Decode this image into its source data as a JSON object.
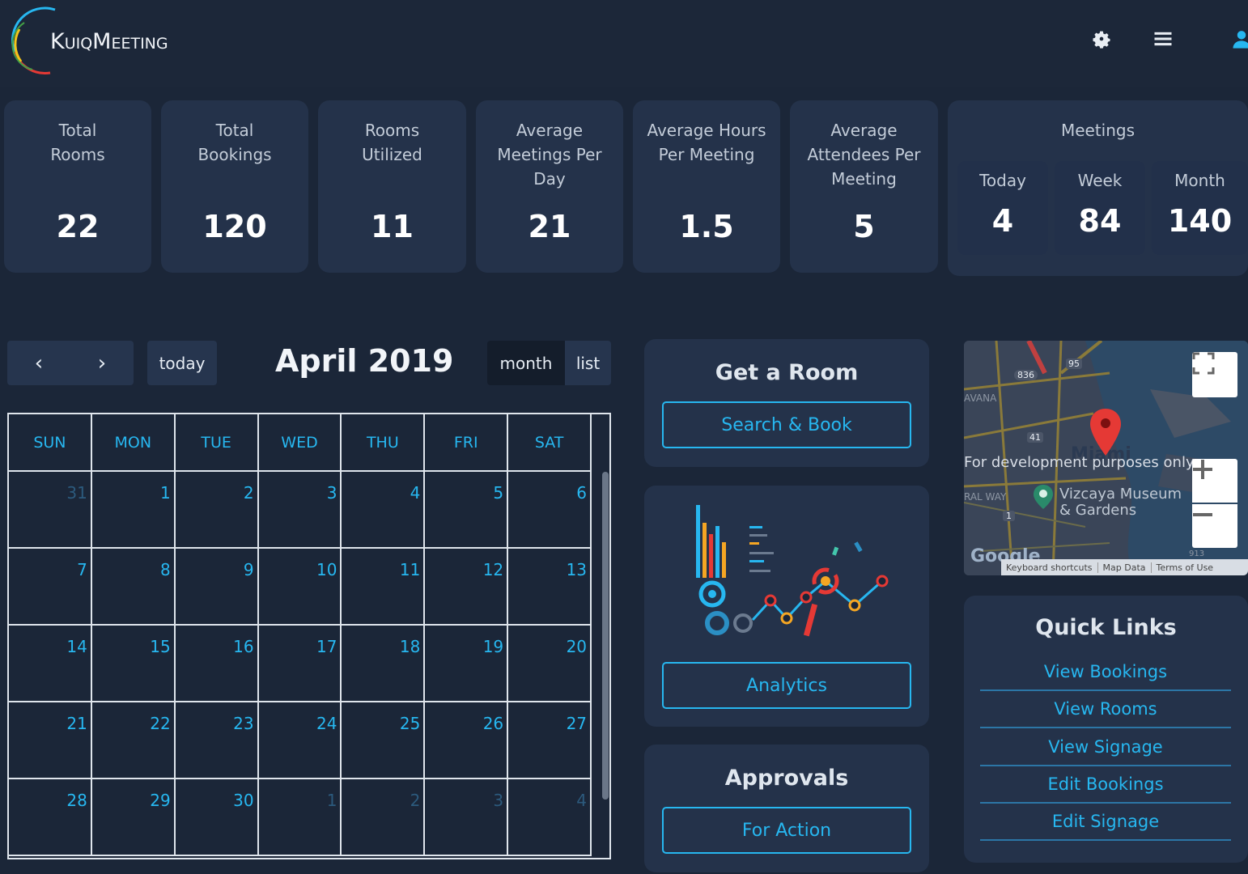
{
  "header": {
    "logo_text": "KuiqMeeting",
    "icons": [
      "gear-icon",
      "hamburger-menu-icon",
      "user-icon"
    ]
  },
  "stats": [
    {
      "label": "Total Rooms",
      "value": "22"
    },
    {
      "label": "Total Bookings",
      "value": "120"
    },
    {
      "label": "Rooms Utilized",
      "value": "11"
    },
    {
      "label": "Average Meetings Per Day",
      "value": "21"
    },
    {
      "label": "Average Hours Per Meeting",
      "value": "1.5"
    },
    {
      "label": "Average Attendees Per Meeting",
      "value": "5"
    }
  ],
  "meetings": {
    "title": "Meetings",
    "today_label": "Today",
    "today_value": "4",
    "week_label": "Week",
    "week_value": "84",
    "month_label": "Month",
    "month_value": "140"
  },
  "calendar": {
    "prev_glyph": "‹",
    "next_glyph": "›",
    "today_label": "today",
    "title": "April 2019",
    "view_month": "month",
    "view_list": "list",
    "weekdays": [
      "SUN",
      "MON",
      "TUE",
      "WED",
      "THU",
      "FRI",
      "SAT"
    ],
    "weeks": [
      [
        "31",
        "1",
        "2",
        "3",
        "4",
        "5",
        "6"
      ],
      [
        "7",
        "8",
        "9",
        "10",
        "11",
        "12",
        "13"
      ],
      [
        "14",
        "15",
        "16",
        "17",
        "18",
        "19",
        "20"
      ],
      [
        "21",
        "22",
        "23",
        "24",
        "25",
        "26",
        "27"
      ],
      [
        "28",
        "29",
        "30",
        "1",
        "2",
        "3",
        "4"
      ]
    ]
  },
  "get_room": {
    "title": "Get a Room",
    "button": "Search & Book"
  },
  "analytics": {
    "button": "Analytics"
  },
  "approvals": {
    "title": "Approvals",
    "button": "For Action"
  },
  "map": {
    "dev_notice": "For development purposes only",
    "city": "Miami",
    "poi": "Vizcaya Museum & Gardens",
    "poi_line1": "Vizcaya Museum",
    "poi_line2": "& Gardens",
    "road_label_1": "AVANA",
    "road_label_2": "RAL WAY",
    "shield_1": "836",
    "shield_2": "95",
    "shield_3": "41",
    "shield_4": "1",
    "shield_5": "913",
    "google": "Google",
    "keyboard": "Keyboard shortcuts",
    "map_data": "Map Data",
    "terms": "Terms of Use"
  },
  "quick_links": {
    "title": "Quick Links",
    "links": [
      "View Bookings",
      "View Rooms",
      "View Signage",
      "Edit Bookings",
      "Edit Signage"
    ]
  },
  "colors": {
    "background": "#1b2638",
    "card": "#24324a",
    "accent": "#27b7f0",
    "marker": "#e53935"
  }
}
